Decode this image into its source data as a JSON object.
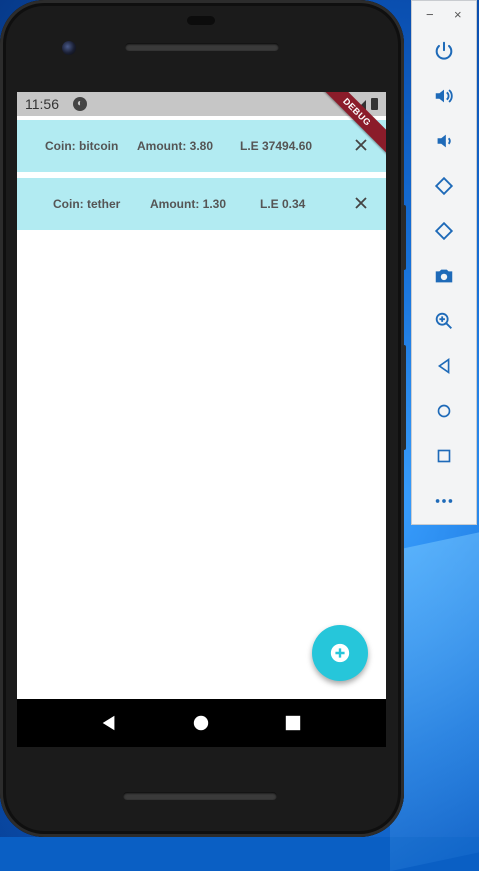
{
  "device": {
    "status_time": "11:56",
    "debug_banner": "DEBUG"
  },
  "coins": [
    {
      "coin_label": "Coin: bitcoin",
      "amount_label": "Amount: 3.80",
      "value_label": "L.E 37494.60"
    },
    {
      "coin_label": "Coin: tether",
      "amount_label": "Amount: 1.30",
      "value_label": "L.E 0.34"
    }
  ],
  "fab": {
    "icon": "add-circle-icon"
  },
  "navbar": {
    "icons": [
      "back-icon",
      "home-icon",
      "recents-icon"
    ]
  },
  "emulator_toolbar": {
    "window_controls": [
      "−",
      "×"
    ],
    "icons": [
      "power-icon",
      "volume-up-icon",
      "volume-down-icon",
      "rotate-left-icon",
      "rotate-right-icon",
      "camera-icon",
      "zoom-icon",
      "back-icon",
      "home-icon",
      "overview-icon",
      "more-icon"
    ]
  },
  "colors": {
    "row_background": "#b2ebf2",
    "fab": "#26c6da",
    "status_bar": "#c6c6c6",
    "debug_banner": "#8b1c2a"
  }
}
